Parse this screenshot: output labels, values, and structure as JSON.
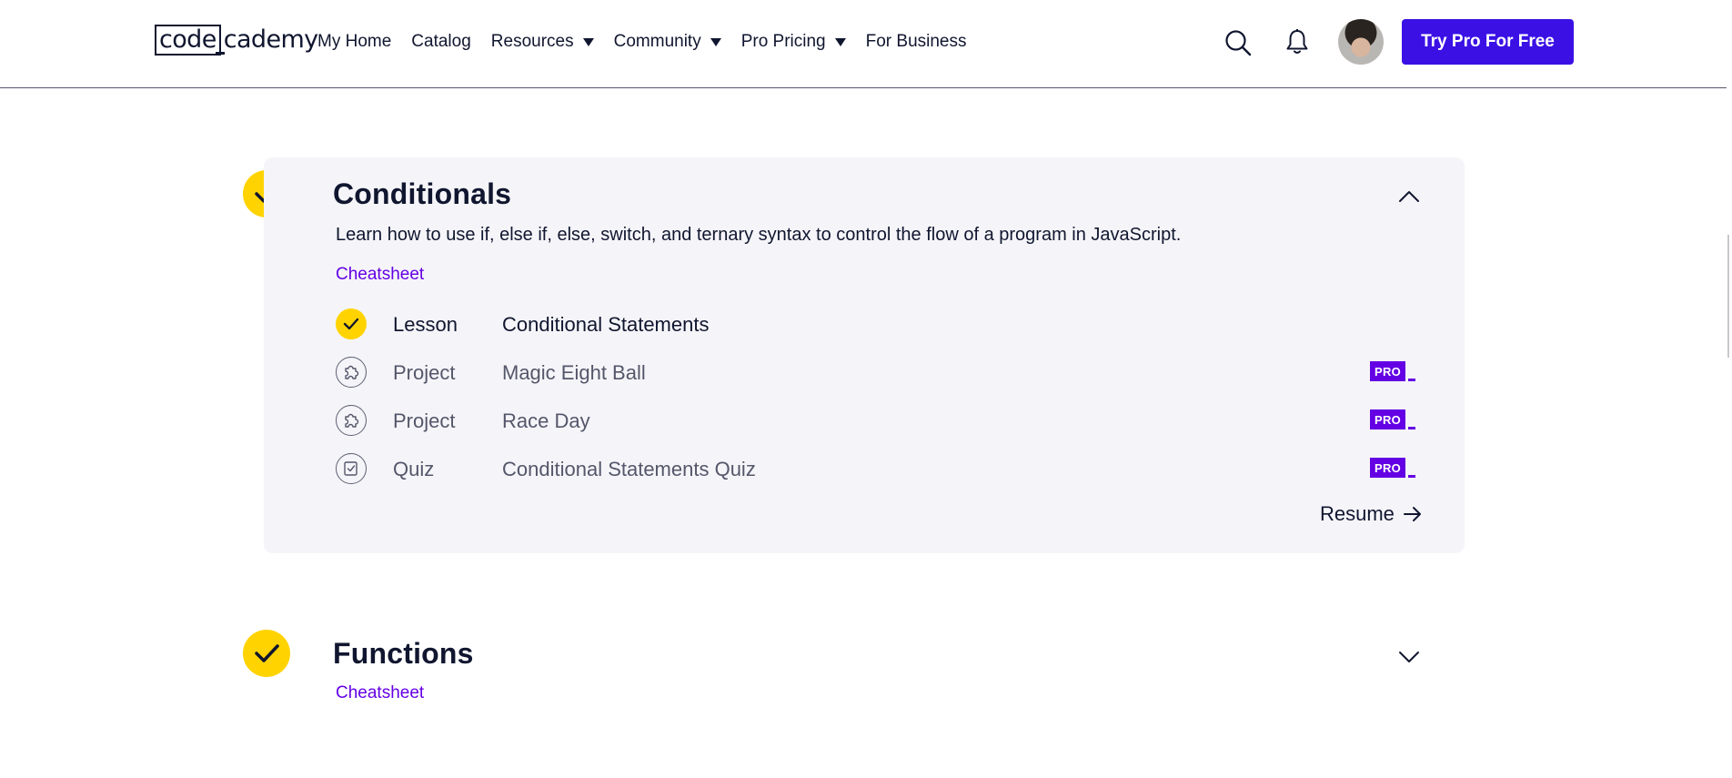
{
  "header": {
    "logo": {
      "part1": "code",
      "part2": "cademy"
    },
    "nav": [
      {
        "label": "My Home",
        "dropdown": false
      },
      {
        "label": "Catalog",
        "dropdown": false
      },
      {
        "label": "Resources",
        "dropdown": true
      },
      {
        "label": "Community",
        "dropdown": true
      },
      {
        "label": "Pro Pricing",
        "dropdown": true
      },
      {
        "label": "For Business",
        "dropdown": false
      }
    ],
    "cta_label": "Try Pro For Free",
    "icons": [
      "search-icon",
      "bell-icon",
      "avatar"
    ]
  },
  "colors": {
    "accent": "#3a10e5",
    "link": "#6400e4",
    "complete": "#ffd300",
    "card_bg": "#f5f5f9",
    "text": "#10162f"
  },
  "modules": [
    {
      "title": "Conditionals",
      "expanded": true,
      "completed": true,
      "description": "Learn how to use if, else if, else, switch, and ternary syntax to control the flow of a program in JavaScript.",
      "cheatsheet_label": "Cheatsheet",
      "items": [
        {
          "type": "Lesson",
          "name": "Conditional Statements",
          "status": "completed",
          "icon": "check-icon",
          "pro": false
        },
        {
          "type": "Project",
          "name": "Magic Eight Ball",
          "status": "locked",
          "icon": "puzzle-icon",
          "pro": true
        },
        {
          "type": "Project",
          "name": "Race Day",
          "status": "locked",
          "icon": "puzzle-icon",
          "pro": true
        },
        {
          "type": "Quiz",
          "name": "Conditional Statements Quiz",
          "status": "locked",
          "icon": "quiz-icon",
          "pro": true
        }
      ],
      "pro_badge_label": "PRO",
      "resume_label": "Resume"
    },
    {
      "title": "Functions",
      "expanded": false,
      "completed": true,
      "cheatsheet_label": "Cheatsheet"
    }
  ]
}
